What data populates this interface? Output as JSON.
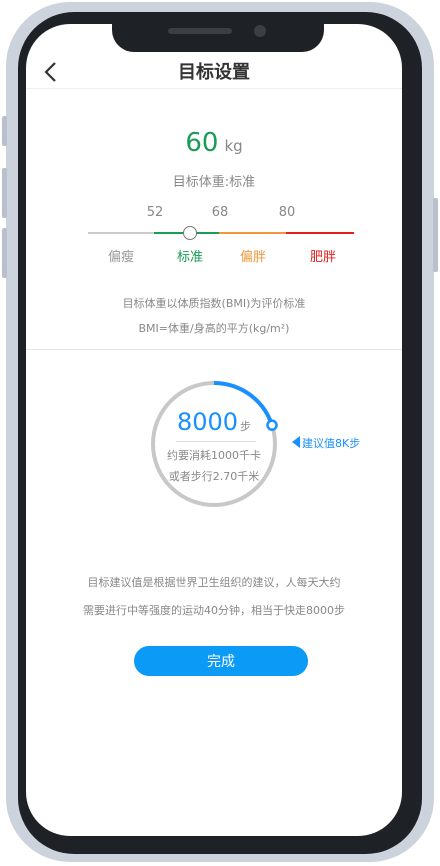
{
  "header": {
    "title": "目标设置"
  },
  "weight": {
    "value": "60",
    "unit": "kg",
    "label": "目标体重:标准"
  },
  "bmi_scale": {
    "ticks": [
      "52",
      "68",
      "80"
    ],
    "categories": [
      {
        "label": "偏瘦",
        "color": "#999999"
      },
      {
        "label": "标准",
        "color": "#1a9b56"
      },
      {
        "label": "偏胖",
        "color": "#f0963c"
      },
      {
        "label": "肥胖",
        "color": "#e02020"
      }
    ]
  },
  "bmi_info": {
    "line1": "目标体重以体质指数(BMI)为评价标准",
    "line2": "BMI=体重/身高的平方(kg/m²)"
  },
  "steps": {
    "value": "8000",
    "unit": "步",
    "calories": "约要消耗1000千卡",
    "distance": "或者步行2.70千米",
    "suggestion": "建议值8K步",
    "progress_fraction": 0.2
  },
  "note": {
    "line1": "目标建议值是根据世界卫生组织的建议，人每天大约",
    "line2": "需要进行中等强度的运动40分钟，相当于快走8000步"
  },
  "done_button": "完成",
  "colors": {
    "accent": "#1890ff",
    "button": "#0b9af5",
    "normal": "#1a9b56",
    "overweight": "#f0963c",
    "obese": "#e02020"
  }
}
